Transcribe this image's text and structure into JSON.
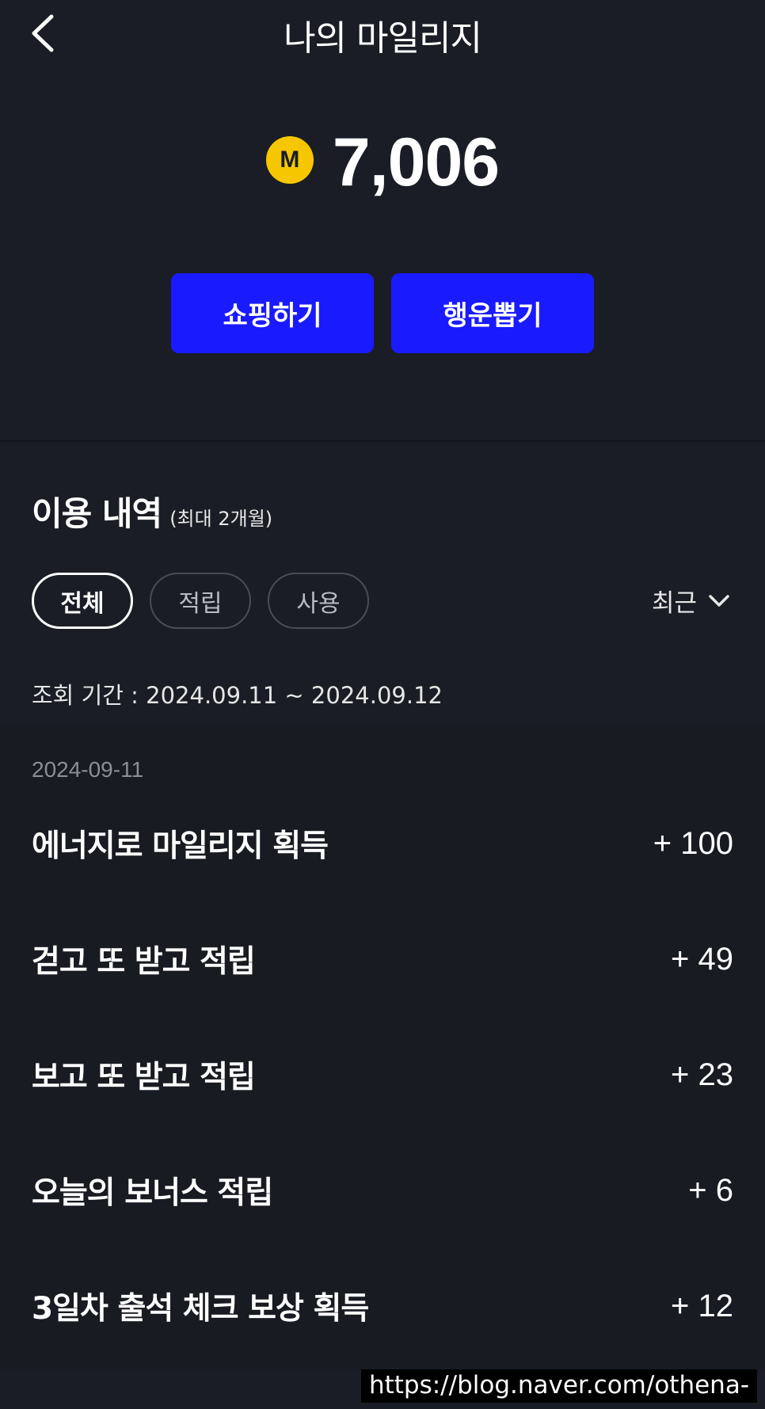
{
  "header": {
    "title": "나의 마일리지",
    "back_icon": "chevron-left-icon"
  },
  "balance": {
    "coin_letter": "M",
    "value": "7,006",
    "coin_color": "#f6c700"
  },
  "actions": [
    {
      "label": "쇼핑하기"
    },
    {
      "label": "행운뽑기"
    }
  ],
  "accent_color": "#1a1aff",
  "history": {
    "title": "이용 내역",
    "subtitle": "(최대 2개월)",
    "filters": [
      {
        "label": "전체",
        "selected": true
      },
      {
        "label": "적립",
        "selected": false
      },
      {
        "label": "사용",
        "selected": false
      }
    ],
    "sort_label": "최근",
    "period": "조회 기간 : 2024.09.11 ~ 2024.09.12",
    "date": "2024-09-11",
    "transactions": [
      {
        "label": "에너지로 마일리지 획득",
        "amount": "+ 100"
      },
      {
        "label": "걷고 또 받고 적립",
        "amount": "+ 49"
      },
      {
        "label": "보고 또 받고 적립",
        "amount": "+ 23"
      },
      {
        "label": "오늘의 보너스 적립",
        "amount": "+ 6"
      },
      {
        "label": "3일차 출석 체크 보상 획득",
        "amount": "+ 12"
      }
    ]
  },
  "watermark": "https://blog.naver.com/othena-"
}
